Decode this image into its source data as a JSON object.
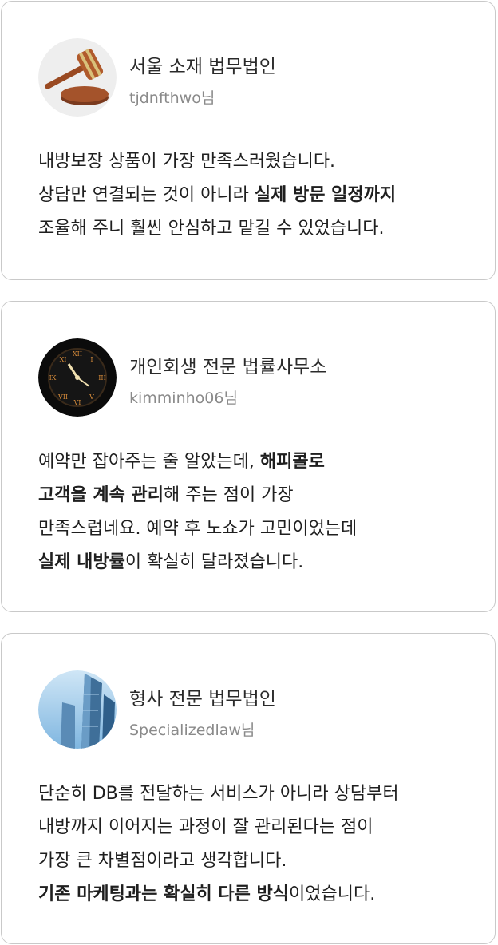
{
  "reviews": [
    {
      "firm": "서울 소재 법무법인",
      "user": "tjdnfthwo님",
      "avatar_icon": "gavel-icon",
      "lines": [
        [
          {
            "t": "내방보장 상품이 가장 만족스러웠습니다.",
            "b": false
          }
        ],
        [
          {
            "t": "상담만 연결되는 것이 아니라 ",
            "b": false
          },
          {
            "t": "실제 방문 일정까지",
            "b": true
          }
        ],
        [
          {
            "t": "조율해 주니 훨씬 안심하고 맡길 수 있었습니다.",
            "b": false
          }
        ]
      ]
    },
    {
      "firm": "개인회생 전문 법률사무소",
      "user": "kimminho06님",
      "avatar_icon": "clock-icon",
      "lines": [
        [
          {
            "t": "예약만 잡아주는 줄 알았는데, ",
            "b": false
          },
          {
            "t": "해피콜로",
            "b": true
          }
        ],
        [
          {
            "t": "고객을 계속 관리",
            "b": true
          },
          {
            "t": "해 주는 점이 가장",
            "b": false
          }
        ],
        [
          {
            "t": "만족스럽네요. 예약 후 노쇼가 고민이었는데",
            "b": false
          }
        ],
        [
          {
            "t": "실제 내방률",
            "b": true
          },
          {
            "t": "이 확실히 달라졌습니다.",
            "b": false
          }
        ]
      ]
    },
    {
      "firm": "형사 전문 법무법인",
      "user": "Specializedlaw님",
      "avatar_icon": "building-icon",
      "lines": [
        [
          {
            "t": "단순히 DB를 전달하는 서비스가 아니라 상담부터",
            "b": false
          }
        ],
        [
          {
            "t": "내방까지 이어지는 과정이 잘 관리된다는 점이",
            "b": false
          }
        ],
        [
          {
            "t": "가장 큰 차별점이라고 생각합니다.",
            "b": false
          }
        ],
        [
          {
            "t": "기존 마케팅과는 확실히 다른 방식",
            "b": true
          },
          {
            "t": "이었습니다.",
            "b": false
          }
        ]
      ]
    }
  ]
}
